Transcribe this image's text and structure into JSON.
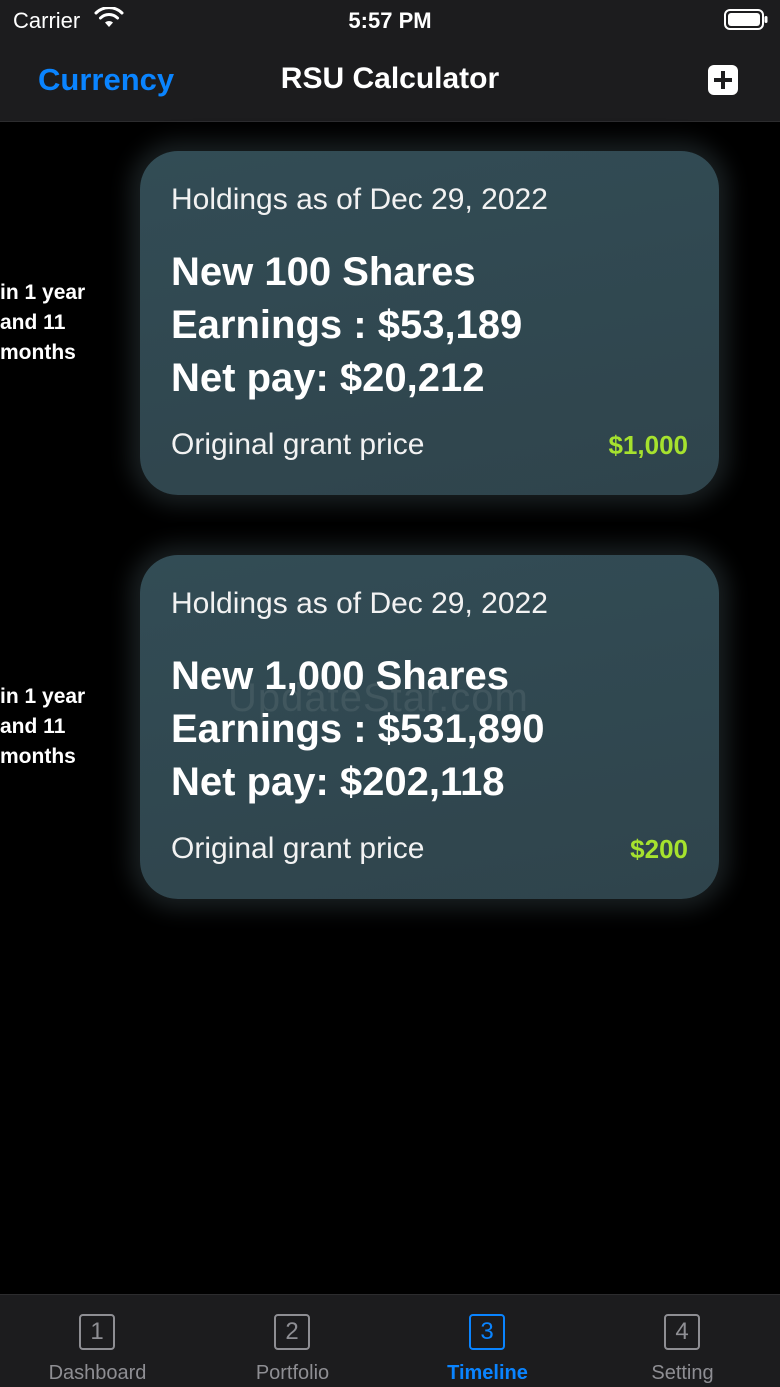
{
  "status_bar": {
    "carrier": "Carrier",
    "time": "5:57 PM"
  },
  "nav": {
    "left_label": "Currency",
    "title": "RSU Calculator",
    "right_icon": "plus-square-icon"
  },
  "entries": [
    {
      "time_label": "in 1 year and 11 months",
      "holdings": "Holdings as of Dec 29, 2022",
      "shares": "New 100 Shares",
      "earnings": "Earnings : $53,189",
      "net_pay": "Net pay: $20,212",
      "grant_label": "Original grant price",
      "grant_value": "$1,000"
    },
    {
      "time_label": "in 1 year and 11 months",
      "holdings": "Holdings as of Dec 29, 2022",
      "shares": "New 1,000 Shares",
      "earnings": "Earnings : $531,890",
      "net_pay": "Net pay: $202,118",
      "grant_label": "Original grant price",
      "grant_value": "$200"
    }
  ],
  "watermark": "UpdateStar.com",
  "tabs": [
    {
      "number": "1",
      "label": "Dashboard"
    },
    {
      "number": "2",
      "label": "Portfolio"
    },
    {
      "number": "3",
      "label": "Timeline",
      "active": true
    },
    {
      "number": "4",
      "label": "Setting"
    }
  ],
  "colors": {
    "accent": "#0a84ff",
    "grant_value": "#a6e22e",
    "card": "#324c55",
    "bar_background": "#1c1c1e"
  }
}
